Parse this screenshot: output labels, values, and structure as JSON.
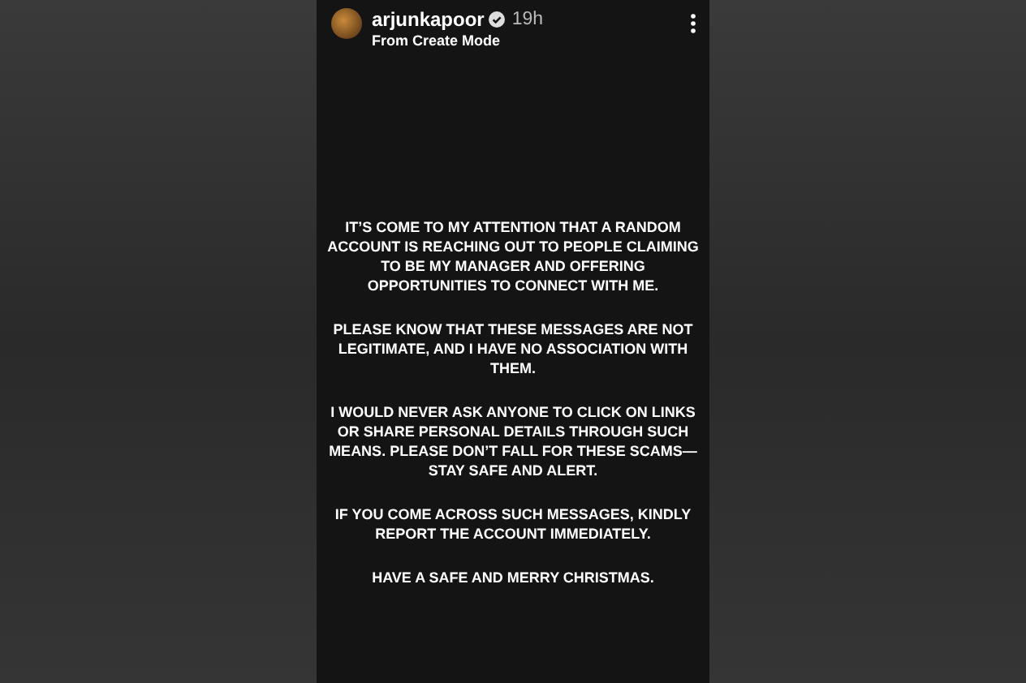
{
  "story": {
    "username": "arjunkapoor",
    "verified": true,
    "time": "19h",
    "subtitle": "From Create Mode",
    "paragraphs": [
      "IT’S COME TO MY ATTENTION THAT A RANDOM ACCOUNT IS REACHING OUT TO PEOPLE CLAIMING TO BE MY MANAGER AND OFFERING OPPORTUNITIES TO CONNECT WITH ME.",
      "PLEASE KNOW THAT THESE MESSAGES ARE NOT LEGITIMATE, AND I HAVE NO ASSOCIATION WITH THEM.",
      "I WOULD NEVER ASK ANYONE TO CLICK ON LINKS OR SHARE PERSONAL DETAILS THROUGH SUCH MEANS. PLEASE DON’T FALL FOR THESE SCAMS—STAY SAFE AND ALERT.",
      "IF YOU COME ACROSS SUCH MESSAGES, KINDLY REPORT THE ACCOUNT IMMEDIATELY.",
      "HAVE A SAFE AND MERRY CHRISTMAS."
    ]
  }
}
